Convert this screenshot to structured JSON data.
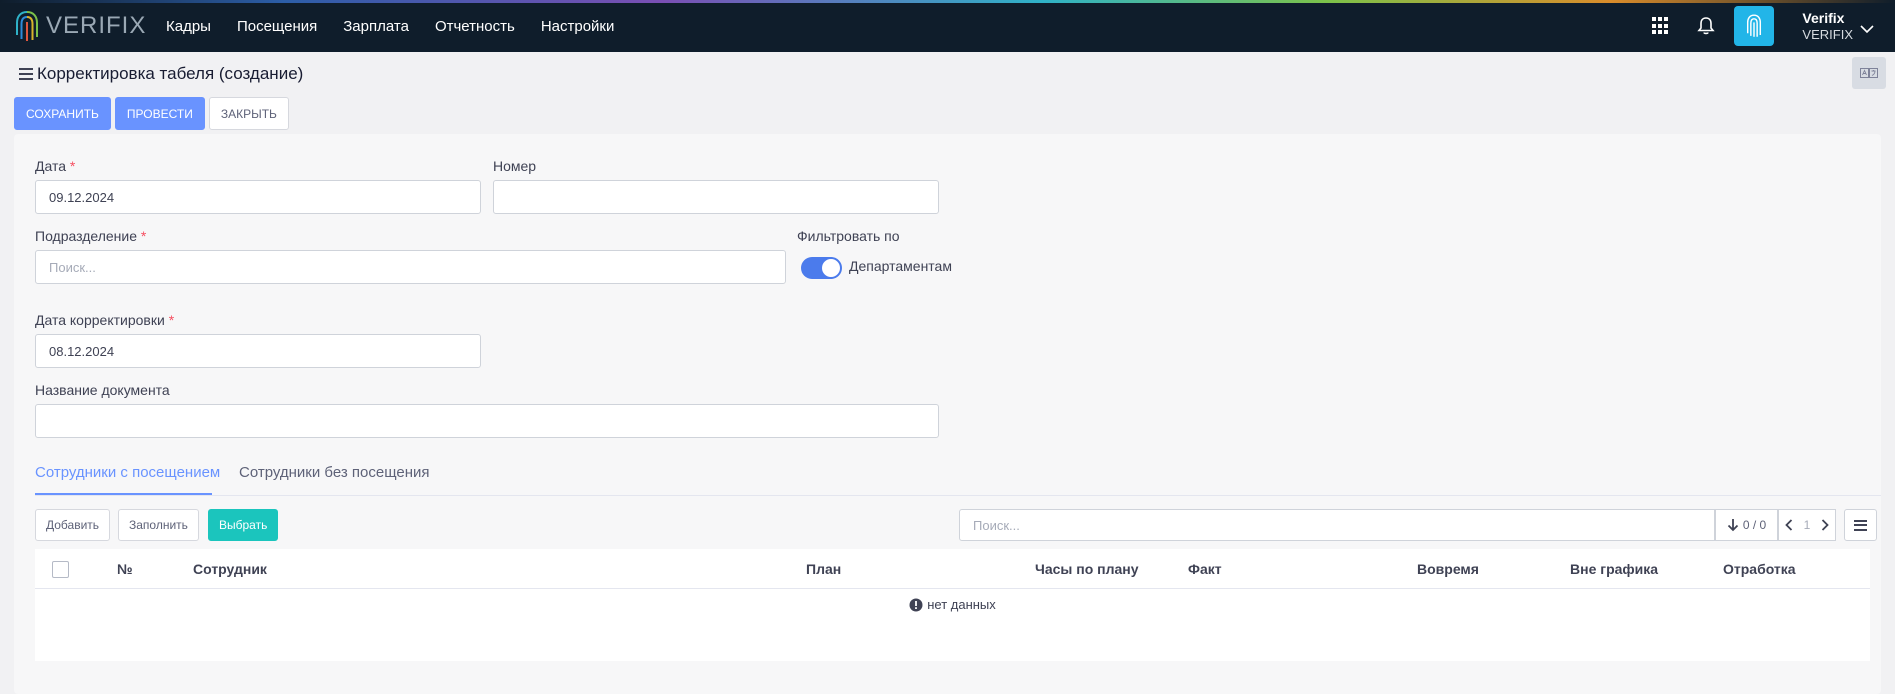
{
  "app": {
    "logo_text": "VERIFIX"
  },
  "nav": [
    "Кадры",
    "Посещения",
    "Зарплата",
    "Отчетность",
    "Настройки"
  ],
  "user": {
    "name": "Verifix",
    "org": "VERIFIX"
  },
  "page": {
    "title": "Корректировка табеля (создание)"
  },
  "actions": {
    "save": "СОХРАНИТЬ",
    "post": "ПРОВЕСТИ",
    "close": "ЗАКРЫТЬ"
  },
  "form": {
    "date_label": "Дата",
    "date_value": "09.12.2024",
    "number_label": "Номер",
    "number_value": "",
    "division_label": "Подразделение",
    "division_placeholder": "Поиск...",
    "filter_label": "Фильтровать по",
    "filter_toggle_label": "Департаментам",
    "filter_toggle_on": true,
    "correction_date_label": "Дата корректировки",
    "correction_date_value": "08.12.2024",
    "doc_name_label": "Название документа",
    "doc_name_value": "",
    "required_mark": "*"
  },
  "tabs": [
    {
      "label": "Сотрудники с посещением",
      "active": true
    },
    {
      "label": "Сотрудники без посещения",
      "active": false
    }
  ],
  "grid": {
    "add": "Добавить",
    "fill": "Заполнить",
    "select": "Выбрать",
    "search_placeholder": "Поиск...",
    "counter": "0 / 0",
    "page": "1",
    "columns": [
      "№",
      "Сотрудник",
      "План",
      "Часы по плану",
      "Факт",
      "Вовремя",
      "Вне графика",
      "Отработка"
    ],
    "empty_text": "нет данных"
  },
  "colors": {
    "primary": "#6993ff",
    "teal": "#1bc5bd",
    "topbar": "#0f1d2b",
    "required": "#f64e60"
  }
}
